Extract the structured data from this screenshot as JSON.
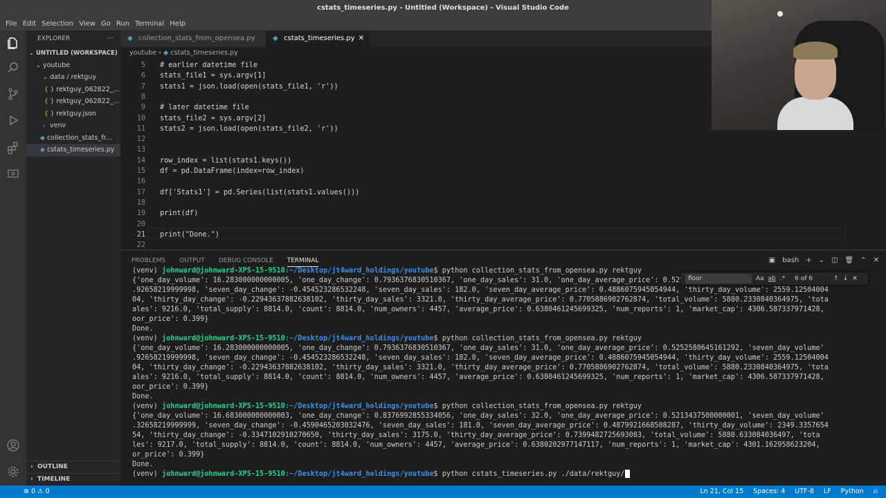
{
  "window": {
    "title": "cstats_timeseries.py - Untitled (Workspace) - Visual Studio Code"
  },
  "menu": [
    "File",
    "Edit",
    "Selection",
    "View",
    "Go",
    "Run",
    "Terminal",
    "Help"
  ],
  "sidebar": {
    "header": "EXPLORER",
    "more": "···",
    "workspace": "UNTITLED (WORKSPACE)",
    "items": [
      {
        "label": "youtube",
        "chev": "⌄"
      },
      {
        "label": "data / rektguy",
        "chev": "⌄"
      },
      {
        "label": "rektguy_062822_...",
        "icon": "{ }"
      },
      {
        "label": "rektguy_062822_...",
        "icon": "{ }"
      },
      {
        "label": "rektguy.json",
        "icon": "{ }"
      },
      {
        "label": "venv",
        "chev": "›"
      },
      {
        "label": "collection_stats_fr...",
        "icon": "◆"
      },
      {
        "label": "cstats_timeseries.py",
        "icon": "◆"
      }
    ],
    "outline": "OUTLINE",
    "timeline": "TIMELINE"
  },
  "tabs": [
    {
      "label": "collection_stats_from_opensea.py"
    },
    {
      "label": "cstats_timeseries.py",
      "close": "✕"
    }
  ],
  "breadcrumb": {
    "folder": "youtube",
    "sep": "›",
    "file": "cstats_timeseries.py"
  },
  "code": [
    {
      "n": "5",
      "t": "# earlier datetime file"
    },
    {
      "n": "6",
      "t": "stats_file1 = sys.argv[1]"
    },
    {
      "n": "7",
      "t": "stats1 = json.load(open(stats_file1, 'r'))"
    },
    {
      "n": "8",
      "t": ""
    },
    {
      "n": "9",
      "t": "# later datetime file"
    },
    {
      "n": "10",
      "t": "stats_file2 = sys.argv[2]"
    },
    {
      "n": "11",
      "t": "stats2 = json.load(open(stats_file2, 'r'))"
    },
    {
      "n": "12",
      "t": ""
    },
    {
      "n": "13",
      "t": ""
    },
    {
      "n": "14",
      "t": "row_index = list(stats1.keys())"
    },
    {
      "n": "15",
      "t": "df = pd.DataFrame(index=row_index)"
    },
    {
      "n": "16",
      "t": ""
    },
    {
      "n": "17",
      "t": "df['Stats1'] = pd.Series(list(stats1.values()))"
    },
    {
      "n": "18",
      "t": ""
    },
    {
      "n": "19",
      "t": "print(df)"
    },
    {
      "n": "20",
      "t": ""
    },
    {
      "n": "21",
      "t": "print(\"Done.\")"
    },
    {
      "n": "22",
      "t": ""
    }
  ],
  "panel": {
    "tabs": [
      "PROBLEMS",
      "OUTPUT",
      "DEBUG CONSOLE",
      "TERMINAL"
    ],
    "shell": "bash",
    "find": {
      "value": "floor",
      "opts": [
        "Aa",
        "ab",
        ".*"
      ],
      "count": "6 of 6"
    }
  },
  "terminal": {
    "lines": [
      {
        "prefix": "(venv) ",
        "user": "johnward@johnward-XPS-15-9510",
        "path": ":~/Desktop/jt4ward_holdings/youtube",
        "cmd": "$ python collection_stats_from_opensea.py rektguy"
      },
      {
        "text": "{'one_day_volume': 16.283000000000005, 'one_day_change': 0.7936376830510367, 'one_day_sales': 31.0, 'one_day_average_price': 0.5252580645161292, 'seven_day_volume'"
      },
      {
        "text": ".92658219999998, 'seven_day_change': -0.454523286532248, 'seven_day_sales': 182.0, 'seven_day_average_price': 0.4886075945054944, 'thirty_day_volume': 2559.12504004"
      },
      {
        "text": "04, 'thirty_day_change': -0.22943637882638102, 'thirty_day_sales': 3321.0, 'thirty_day_average_price': 0.7705886902762874, 'total_volume': 5880.2330840364975, 'tota"
      },
      {
        "text": "ales': 9216.0, 'total_supply': 8814.0, 'count': 8814.0, 'num_owners': 4457, 'average_price': 0.6380461245699325, 'num_reports': 1, 'market_cap': 4306.587337971428,"
      },
      {
        "text": "oor_price': 0.399}"
      },
      {
        "text": "Done."
      },
      {
        "prefix": "(venv) ",
        "user": "johnward@johnward-XPS-15-9510",
        "path": ":~/Desktop/jt4ward_holdings/youtube",
        "cmd": "$ python collection_stats_from_opensea.py rektguy"
      },
      {
        "text": "{'one_day_volume': 16.283000000000005, 'one_day_change': 0.7936376830510367, 'one_day_sales': 31.0, 'one_day_average_price': 0.5252580645161292, 'seven_day_volume'"
      },
      {
        "text": ".92658219999998, 'seven_day_change': -0.454523286532248, 'seven_day_sales': 182.0, 'seven_day_average_price': 0.4886075945054944, 'thirty_day_volume': 2559.12504004"
      },
      {
        "text": "04, 'thirty_day_change': -0.22943637882638102, 'thirty_day_sales': 3321.0, 'thirty_day_average_price': 0.7705886902762874, 'total_volume': 5880.2330840364975, 'tota"
      },
      {
        "text": "ales': 9216.0, 'total_supply': 8814.0, 'count': 8814.0, 'num_owners': 4457, 'average_price': 0.6380461245699325, 'num_reports': 1, 'market_cap': 4306.587337971428,"
      },
      {
        "text": "oor_price': 0.399}"
      },
      {
        "text": "Done."
      },
      {
        "prefix": "(venv) ",
        "user": "johnward@johnward-XPS-15-9510",
        "path": ":~/Desktop/jt4ward_holdings/youtube",
        "cmd": "$ python collection_stats_from_opensea.py rektguy"
      },
      {
        "text": "{'one_day_volume': 16.683000000000003, 'one_day_change': 0.8376992855334056, 'one_day_sales': 32.0, 'one_day_average_price': 0.5213437500000001, 'seven_day_volume'"
      },
      {
        "text": ".32658219999999, 'seven_day_change': -0.4590465203032476, 'seven_day_sales': 181.0, 'seven_day_average_price': 0.4879921668508287, 'thirty_day_volume': 2349.3357654"
      },
      {
        "text": "54, 'thirty_day_change': -0.3347102910270650, 'thirty_day_sales': 3175.0, 'thirty_day_average_price': 0.7399482725693083, 'total_volume': 5880.633084036497, 'tota"
      },
      {
        "text": "les': 9217.0, 'total_supply': 8814.0, 'count': 8814.0, 'num_owners': 4457, 'average_price': 0.6380202977147117, 'num_reports': 1, 'market_cap': 4301.162958623204,"
      },
      {
        "text": "or_price': 0.399}"
      },
      {
        "text": "Done."
      },
      {
        "prefix": "(venv) ",
        "user": "johnward@johnward-XPS-15-9510",
        "path": ":~/Desktop/jt4ward_holdings/youtube",
        "cmd": "$ python cstats_timeseries.py ./data/rektguy/",
        "cursor": true
      }
    ]
  },
  "status": {
    "left": "⊗ 0 ⚠ 0",
    "position": "Ln 21, Col 15",
    "spaces": "Spaces: 4",
    "encoding": "UTF-8",
    "eol": "LF",
    "language": "Python",
    "bell": "⍾"
  },
  "icons": {
    "explorer": "files-icon",
    "search": "search-icon",
    "scm": "source-control-icon",
    "debug": "run-debug-icon",
    "extensions": "extensions-icon",
    "remote": "remote-icon",
    "account": "account-icon",
    "settings": "gear-icon"
  },
  "colors": {
    "accent": "#007acc",
    "terminal_user": "#23d18b",
    "terminal_path": "#3b8eea"
  }
}
